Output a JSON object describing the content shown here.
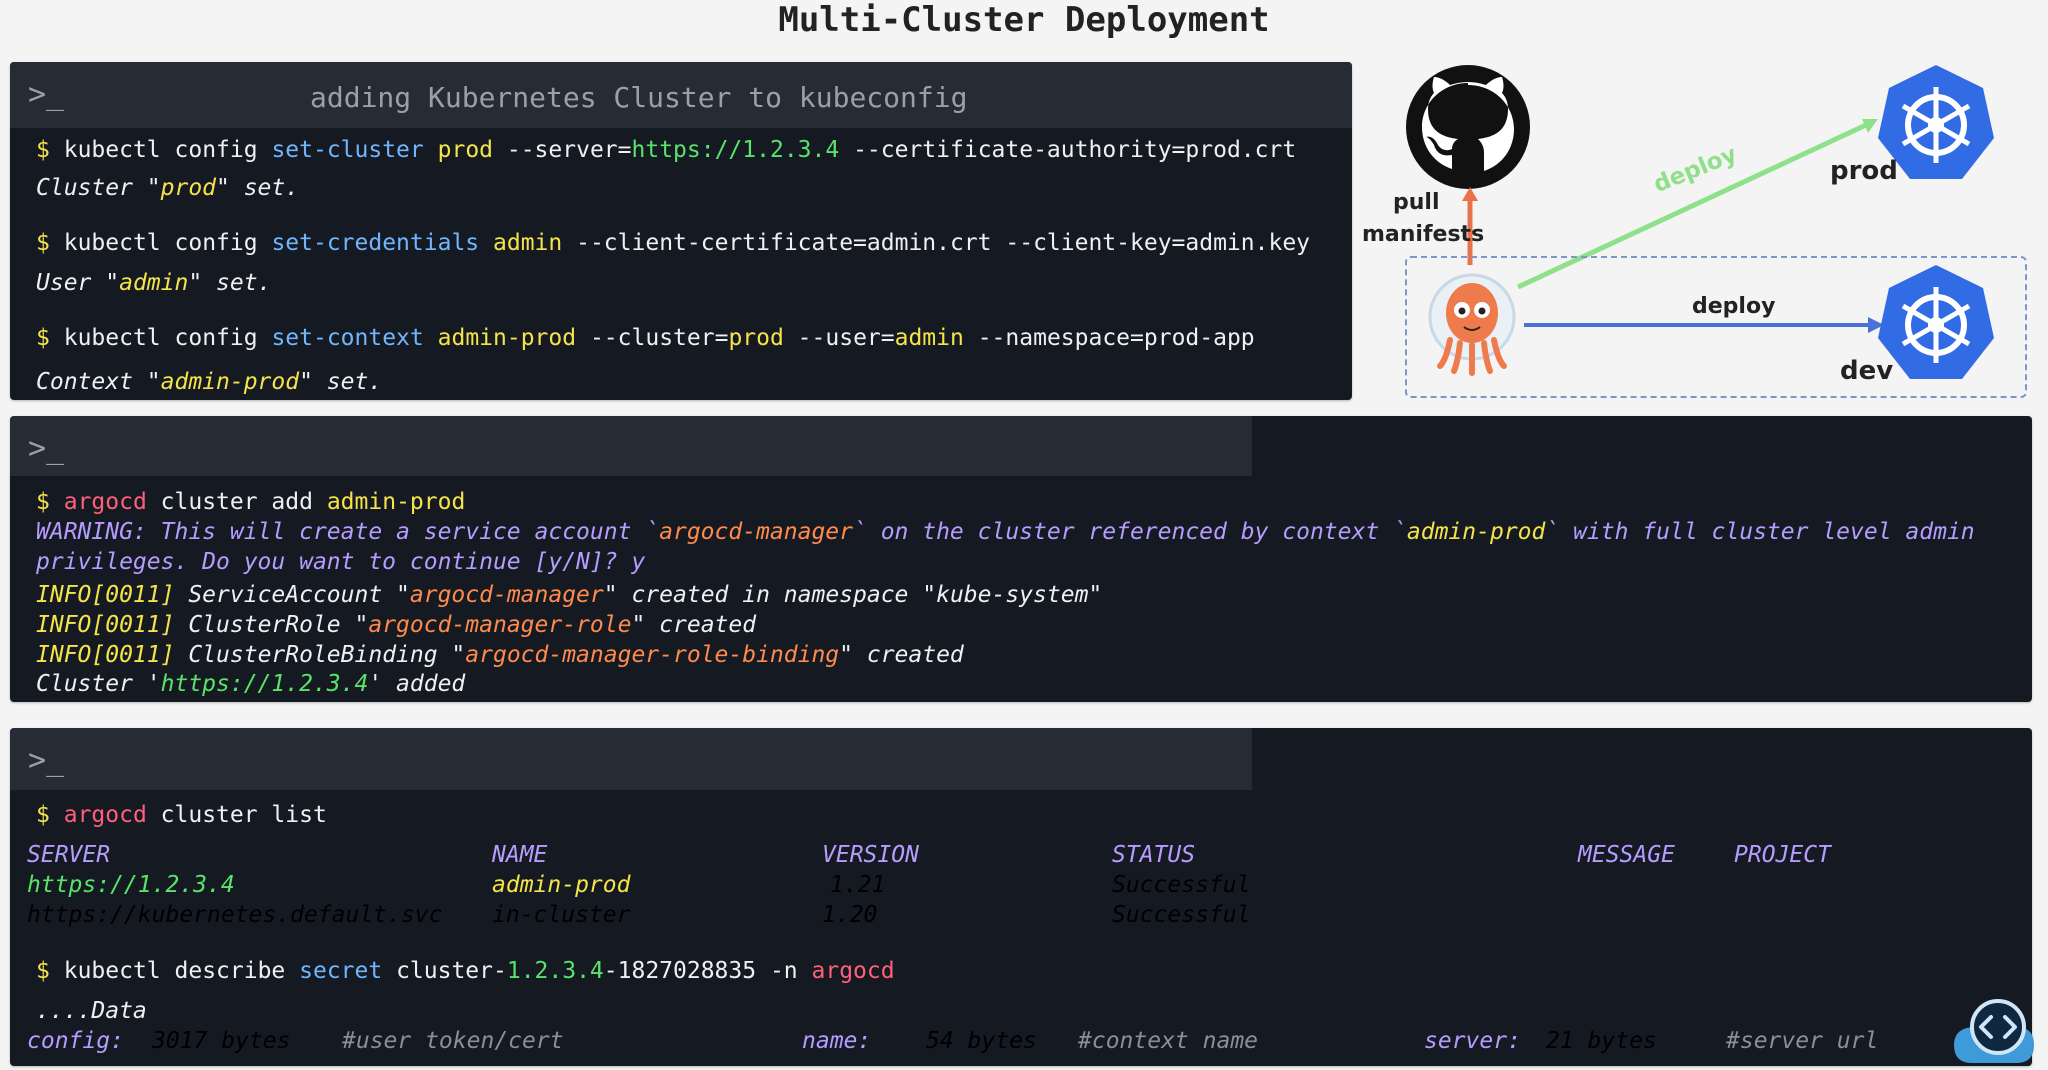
{
  "page": {
    "title": "Multi-Cluster Deployment"
  },
  "terminal1": {
    "prompt_glyph": ">_",
    "heading": "adding Kubernetes Cluster to kubeconfig",
    "cmd1": {
      "dollar": "$",
      "a": "kubectl config ",
      "b": "set-cluster",
      "c": " ",
      "d": "prod",
      "e": " --server=",
      "f": "https://1.2.3.4",
      "g": " --certificate-authority=prod.crt"
    },
    "out1": {
      "a": "Cluster \"",
      "b": "prod",
      "c": "\" set."
    },
    "cmd2": {
      "dollar": "$",
      "a": "kubectl config ",
      "b": "set-credentials",
      "c": " ",
      "d": "admin",
      "e": " --client-certificate=admin.crt --client-key=admin.key"
    },
    "out2": {
      "a": "User \"",
      "b": "admin",
      "c": "\" set."
    },
    "cmd3": {
      "dollar": "$",
      "a": "kubectl config ",
      "b": "set-context",
      "c": " ",
      "d": "admin-prod",
      "e": " --cluster=",
      "f": "prod",
      "g": " --user=",
      "h": "admin",
      "i": " --namespace=prod-app"
    },
    "out3": {
      "a": "Context \"",
      "b": "admin-prod",
      "c": "\" set."
    }
  },
  "terminal2": {
    "prompt_glyph": ">_",
    "cmd": {
      "dollar": "$",
      "a": "argocd",
      "b": " cluster add ",
      "c": "admin-prod"
    },
    "warn1": {
      "a": "WARNING: This will create a service account `",
      "b": "argocd-manager",
      "c": "` on the cluster referenced by context `",
      "d": "admin-prod",
      "e": "` with full cluster level admin"
    },
    "warn2": "privileges. Do you want to continue [y/N]? y",
    "info1": {
      "a": "INFO[0011]",
      "b": " ServiceAccount \"",
      "c": "argocd-manager",
      "d": "\" created in namespace \"kube-system\""
    },
    "info2": {
      "a": "INFO[0011]",
      "b": " ClusterRole \"",
      "c": "argocd-manager-role",
      "d": "\" created"
    },
    "info3": {
      "a": "INFO[0011]",
      "b": " ClusterRoleBinding \"",
      "c": "argocd-manager-role-binding",
      "d": "\" created"
    },
    "added": {
      "a": "Cluster '",
      "b": "https://1.2.3.4",
      "c": "' added"
    }
  },
  "terminal3": {
    "prompt_glyph": ">_",
    "cmd1": {
      "dollar": "$",
      "a": "argocd",
      "b": " cluster list"
    },
    "table": {
      "headers": [
        "SERVER",
        "NAME",
        "VERSION",
        "STATUS",
        "MESSAGE",
        "PROJECT"
      ],
      "rows": [
        [
          "https://1.2.3.4",
          "admin-prod",
          "1.21",
          "Successful"
        ],
        [
          "https://kubernetes.default.svc",
          "in-cluster",
          "1.20",
          "Successful"
        ]
      ]
    },
    "cmd2": {
      "dollar": "$",
      "a": "kubectl describe ",
      "b": "secret",
      "c": " cluster-",
      "d": "1.2.3.4",
      "e": "-1827028835 -n ",
      "f": "argocd"
    },
    "data_heading": "....Data",
    "data": {
      "config_key": "config:",
      "config_val": "3017 bytes",
      "config_comment": "#user token/cert",
      "name_key": "name:",
      "name_val": "54 bytes",
      "name_comment": "#context name",
      "server_key": "server:",
      "server_val": "21 bytes",
      "server_comment": "#server url"
    }
  },
  "diagram": {
    "pull_label_1": "pull",
    "pull_label_2": "manifests",
    "deploy_prod": "deploy",
    "deploy_dev": "deploy",
    "prod_label": "prod",
    "dev_label": "dev",
    "icons": [
      "github-icon",
      "argo-mascot-icon",
      "kubernetes-prod-icon",
      "kubernetes-dev-icon"
    ]
  },
  "colors": {
    "terminal_bg": "#151a22",
    "terminal_header": "#262c36",
    "kubernetes_blue": "#326ce5",
    "deploy_green": "#8fe08a",
    "deploy_blue": "#4a72d8",
    "pull_orange": "#e8734a"
  }
}
